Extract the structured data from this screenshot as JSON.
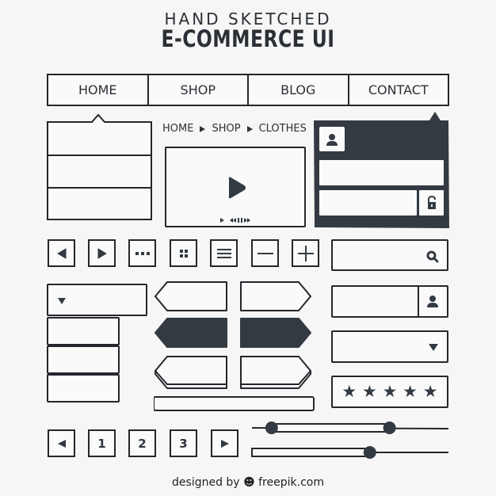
{
  "header": {
    "line1": "HAND SKETCHED",
    "line2": "E-COMMERCE UI"
  },
  "nav": {
    "items": [
      {
        "label": "HOME"
      },
      {
        "label": "SHOP"
      },
      {
        "label": "BLOG"
      },
      {
        "label": "CONTACT"
      }
    ]
  },
  "breadcrumb": {
    "items": [
      "HOME",
      "SHOP",
      "CLOTHES"
    ],
    "separator_icon": "triangle-right-icon"
  },
  "video_player": {
    "center_icon": "play-icon",
    "controls": [
      "play-icon",
      "rewind-icon",
      "pause-icon",
      "fast-forward-icon"
    ]
  },
  "login_panel": {
    "avatar_icon": "user-icon",
    "fields": [
      "username",
      "password"
    ],
    "lock_icon": "unlock-icon",
    "color": "#333a42"
  },
  "icon_buttons": [
    {
      "icon": "arrow-left-icon"
    },
    {
      "icon": "arrow-right-icon"
    },
    {
      "icon": "more-dots-icon"
    },
    {
      "icon": "grid-icon"
    },
    {
      "icon": "menu-icon"
    },
    {
      "icon": "minus-icon"
    },
    {
      "icon": "plus-icon"
    }
  ],
  "search": {
    "placeholder": "",
    "icon": "search-icon"
  },
  "dropdown_left": {
    "icon": "caret-down-icon",
    "options_count_visible": 3
  },
  "arrow_buttons": {
    "rows": [
      "outline",
      "filled",
      "3d-outline"
    ]
  },
  "user_input": {
    "icon": "user-icon"
  },
  "select_right": {
    "icon": "caret-down-icon"
  },
  "rating": {
    "value": 5,
    "max": 5
  },
  "pagination": {
    "prev_icon": "arrow-left-icon",
    "pages": [
      "1",
      "2",
      "3"
    ],
    "next_icon": "arrow-right-icon"
  },
  "sliders": {
    "range": {
      "low": 0.1,
      "high": 0.7
    },
    "single": {
      "value": 0.6
    }
  },
  "footer": {
    "prefix": "designed by",
    "brand": "freepik.com"
  },
  "colors": {
    "ink": "#23272c",
    "fill": "#333a42",
    "background": "#f6f6f6"
  }
}
